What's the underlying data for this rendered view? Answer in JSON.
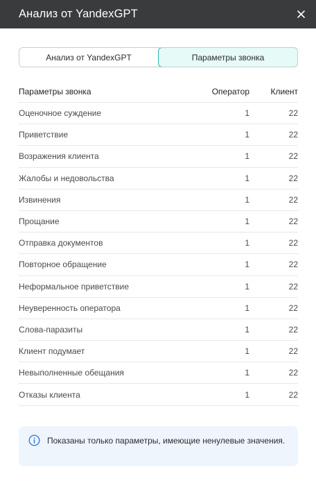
{
  "header": {
    "title": "Анализ от YandexGPT"
  },
  "tabs": [
    {
      "label": "Анализ от YandexGPT",
      "active": false
    },
    {
      "label": "Параметры звонка",
      "active": true
    }
  ],
  "table": {
    "columns": [
      "Параметры звонка",
      "Оператор",
      "Клиент"
    ],
    "rows": [
      {
        "name": "Оценочное суждение",
        "operator": "1",
        "client": "22"
      },
      {
        "name": "Приветствие",
        "operator": "1",
        "client": "22"
      },
      {
        "name": "Возражения клиента",
        "operator": "1",
        "client": "22"
      },
      {
        "name": "Жалобы и недовольства",
        "operator": "1",
        "client": "22"
      },
      {
        "name": "Извинения",
        "operator": "1",
        "client": "22"
      },
      {
        "name": "Прощание",
        "operator": "1",
        "client": "22"
      },
      {
        "name": "Отправка документов",
        "operator": "1",
        "client": "22"
      },
      {
        "name": "Повторное обращение",
        "operator": "1",
        "client": "22"
      },
      {
        "name": "Неформальное приветствие",
        "operator": "1",
        "client": "22"
      },
      {
        "name": "Неуверенность оператора",
        "operator": "1",
        "client": "22"
      },
      {
        "name": "Слова-паразиты",
        "operator": "1",
        "client": "22"
      },
      {
        "name": "Клиент подумает",
        "operator": "1",
        "client": "22"
      },
      {
        "name": "Невыполненные обещания",
        "operator": "1",
        "client": "22"
      },
      {
        "name": "Отказы клиента",
        "operator": "1",
        "client": "22"
      }
    ]
  },
  "info": {
    "icon": "info-icon",
    "text": "Показаны только параметры, имеющие ненулевые значения."
  },
  "colors": {
    "header_bg": "#3a3b3d",
    "active_tab_border": "#27b9a8",
    "active_tab_bg": "#e6faf8",
    "info_bg": "#eff5fd",
    "info_icon": "#2f7fe0"
  }
}
